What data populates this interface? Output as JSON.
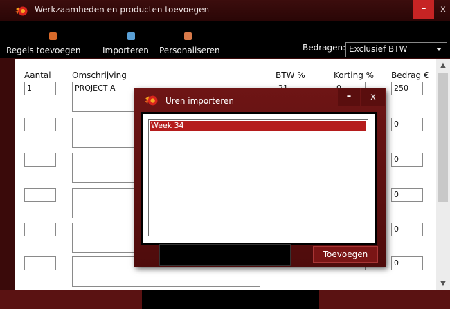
{
  "window": {
    "title": "Werkzaamheden en producten toevoegen",
    "minimize": "–",
    "close": "x"
  },
  "toolbar": {
    "items": [
      {
        "label": "Regels toevoegen",
        "icon": "wallet-icon"
      },
      {
        "label": "Importeren",
        "icon": "import-document-icon"
      },
      {
        "label": "Personaliseren",
        "icon": "personalize-icon"
      }
    ],
    "amounts_label": "Bedragen:",
    "amounts_value": "Exclusief BTW"
  },
  "table": {
    "headers": {
      "qty": "Aantal",
      "desc": "Omschrijving",
      "vat": "BTW %",
      "discount": "Korting %",
      "amount": "Bedrag €"
    },
    "rows": [
      {
        "qty": "1",
        "desc": "PROJECT A",
        "vat": "21",
        "discount": "0",
        "amount": "250"
      },
      {
        "qty": "",
        "desc": "",
        "vat": "",
        "discount": "",
        "amount": "0"
      },
      {
        "qty": "",
        "desc": "",
        "vat": "",
        "discount": "",
        "amount": "0"
      },
      {
        "qty": "",
        "desc": "",
        "vat": "",
        "discount": "",
        "amount": "0"
      },
      {
        "qty": "",
        "desc": "",
        "vat": "",
        "discount": "",
        "amount": "0"
      },
      {
        "qty": "",
        "desc": "",
        "vat": "",
        "discount": "",
        "amount": "0"
      }
    ]
  },
  "modal": {
    "title": "Uren importeren",
    "minimize": "–",
    "close": "x",
    "list_items": [
      "Week 34"
    ],
    "add_button": "Toevoegen"
  },
  "scrollbar": {
    "up": "▲",
    "down": "▼"
  },
  "colors": {
    "accent": "#c62424",
    "selection": "#b51c1c",
    "chrome": "#3a0a0a",
    "modal": "#6e1515"
  }
}
